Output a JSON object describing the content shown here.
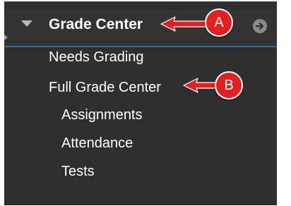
{
  "grade_center": {
    "title": "Grade Center",
    "items": [
      {
        "label": "Needs Grading"
      },
      {
        "label": "Full Grade Center"
      },
      {
        "label": "Assignments"
      },
      {
        "label": "Attendance"
      },
      {
        "label": "Tests"
      }
    ]
  },
  "callouts": {
    "a": "A",
    "b": "B"
  },
  "icons": {
    "expand": "caret-down-icon",
    "open": "arrow-right-circle-icon"
  },
  "colors": {
    "panel_bg": "#2f2f2f",
    "active_border": "#2a6ea6",
    "callout_red": "#e31f1f",
    "text": "#ffffff"
  }
}
